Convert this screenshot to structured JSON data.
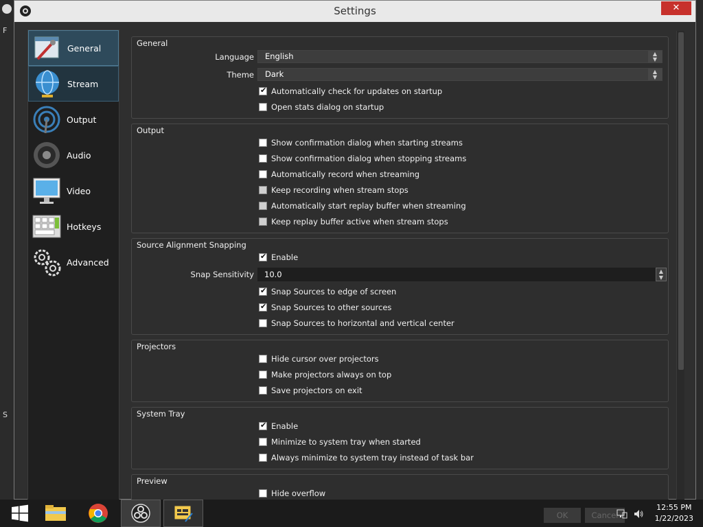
{
  "window": {
    "title": "Settings",
    "close_glyph": "✕"
  },
  "sidebar": {
    "items": [
      {
        "label": "General",
        "icon": "general-icon"
      },
      {
        "label": "Stream",
        "icon": "stream-globe-icon"
      },
      {
        "label": "Output",
        "icon": "output-antenna-icon"
      },
      {
        "label": "Audio",
        "icon": "audio-speaker-icon"
      },
      {
        "label": "Video",
        "icon": "video-monitor-icon"
      },
      {
        "label": "Hotkeys",
        "icon": "hotkeys-keyboard-icon"
      },
      {
        "label": "Advanced",
        "icon": "advanced-gears-icon"
      }
    ]
  },
  "general": {
    "title": "General",
    "language_label": "Language",
    "language_value": "English",
    "theme_label": "Theme",
    "theme_value": "Dark",
    "check_updates": "Automatically check for updates on startup",
    "open_stats": "Open stats dialog on startup"
  },
  "output": {
    "title": "Output",
    "items": [
      "Show confirmation dialog when starting streams",
      "Show confirmation dialog when stopping streams",
      "Automatically record when streaming",
      "Keep recording when stream stops",
      "Automatically start replay buffer when streaming",
      "Keep replay buffer active when stream stops"
    ]
  },
  "snapping": {
    "title": "Source Alignment Snapping",
    "enable": "Enable",
    "sensitivity_label": "Snap Sensitivity",
    "sensitivity_value": "10.0",
    "edge": "Snap Sources to edge of screen",
    "other": "Snap Sources to other sources",
    "center": "Snap Sources to horizontal and vertical center"
  },
  "projectors": {
    "title": "Projectors",
    "items": [
      "Hide cursor over projectors",
      "Make projectors always on top",
      "Save projectors on exit"
    ]
  },
  "tray": {
    "title": "System Tray",
    "enable": "Enable",
    "minimize_started": "Minimize to system tray when started",
    "always_minimize": "Always minimize to system tray instead of task bar"
  },
  "preview": {
    "title": "Preview",
    "hide_overflow": "Hide overflow"
  },
  "dialog_buttons": {
    "ok": "OK",
    "cancel": "Cancel"
  },
  "taskbar": {
    "time": "12:55 PM",
    "date": "1/22/2023"
  },
  "background": {
    "left_letter_top": "F",
    "left_letter_bottom": "S"
  },
  "colors": {
    "accent_active": "#2e4a5b",
    "close_red": "#c7312c",
    "window_bg": "#2f2f2f"
  }
}
